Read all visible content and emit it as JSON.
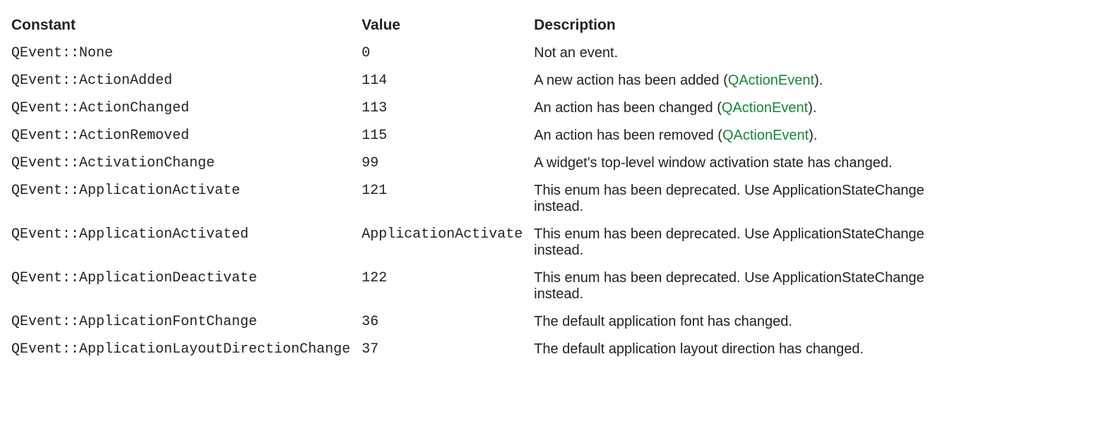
{
  "columns": [
    "Constant",
    "Value",
    "Description"
  ],
  "link_color": "#118833",
  "rows": [
    {
      "constant": "QEvent::None",
      "value": "0",
      "desc_prefix": "Not an event.",
      "link_text": null,
      "desc_suffix": ""
    },
    {
      "constant": "QEvent::ActionAdded",
      "value": "114",
      "desc_prefix": "A new action has been added (",
      "link_text": "QActionEvent",
      "desc_suffix": ")."
    },
    {
      "constant": "QEvent::ActionChanged",
      "value": "113",
      "desc_prefix": "An action has been changed (",
      "link_text": "QActionEvent",
      "desc_suffix": ")."
    },
    {
      "constant": "QEvent::ActionRemoved",
      "value": "115",
      "desc_prefix": "An action has been removed (",
      "link_text": "QActionEvent",
      "desc_suffix": ")."
    },
    {
      "constant": "QEvent::ActivationChange",
      "value": "99",
      "desc_prefix": "A widget's top-level window activation state has changed.",
      "link_text": null,
      "desc_suffix": ""
    },
    {
      "constant": "QEvent::ApplicationActivate",
      "value": "121",
      "desc_prefix": "This enum has been deprecated. Use ApplicationStateChange instead.",
      "link_text": null,
      "desc_suffix": ""
    },
    {
      "constant": "QEvent::ApplicationActivated",
      "value": "ApplicationActivate",
      "desc_prefix": "This enum has been deprecated. Use ApplicationStateChange instead.",
      "link_text": null,
      "desc_suffix": ""
    },
    {
      "constant": "QEvent::ApplicationDeactivate",
      "value": "122",
      "desc_prefix": "This enum has been deprecated. Use ApplicationStateChange instead.",
      "link_text": null,
      "desc_suffix": ""
    },
    {
      "constant": "QEvent::ApplicationFontChange",
      "value": "36",
      "desc_prefix": "The default application font has changed.",
      "link_text": null,
      "desc_suffix": ""
    },
    {
      "constant": "QEvent::ApplicationLayoutDirectionChange",
      "value": "37",
      "desc_prefix": "The default application layout direction has changed.",
      "link_text": null,
      "desc_suffix": ""
    }
  ]
}
